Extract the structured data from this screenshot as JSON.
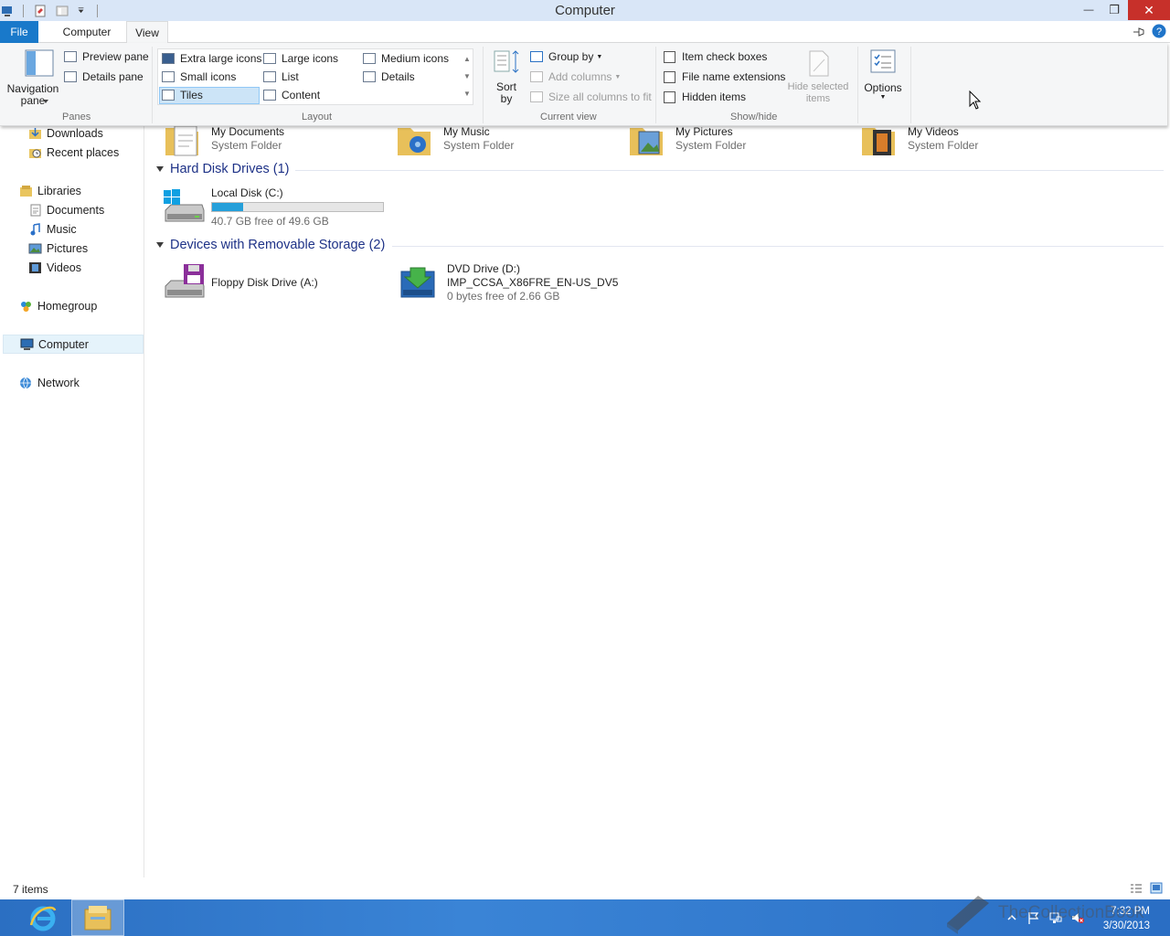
{
  "window": {
    "title": "Computer",
    "minimize": "—",
    "maximize": "❐",
    "close": "✕"
  },
  "tabs": {
    "file": "File",
    "computer": "Computer",
    "view": "View"
  },
  "ribbon": {
    "panes": {
      "label": "Panes",
      "navigation_pane": "Navigation pane",
      "preview_pane": "Preview pane",
      "details_pane": "Details pane"
    },
    "layout": {
      "label": "Layout",
      "items": [
        "Extra large icons",
        "Large icons",
        "Medium icons",
        "Small icons",
        "List",
        "Details",
        "Tiles",
        "Content"
      ],
      "selected": "Tiles"
    },
    "current_view": {
      "label": "Current view",
      "sort_by": "Sort by",
      "group_by": "Group by",
      "add_columns": "Add columns",
      "size_all_columns": "Size all columns to fit"
    },
    "show_hide": {
      "label": "Show/hide",
      "item_check_boxes": "Item check boxes",
      "file_name_extensions": "File name extensions",
      "hidden_items": "Hidden items",
      "hide_selected_items": "Hide selected items"
    },
    "options": "Options"
  },
  "nav": {
    "downloads": "Downloads",
    "recent_places": "Recent places",
    "libraries": "Libraries",
    "documents": "Documents",
    "music": "Music",
    "pictures": "Pictures",
    "videos": "Videos",
    "homegroup": "Homegroup",
    "computer": "Computer",
    "network": "Network"
  },
  "content": {
    "folders": [
      {
        "name": "My Documents",
        "type": "System Folder"
      },
      {
        "name": "My Music",
        "type": "System Folder"
      },
      {
        "name": "My Pictures",
        "type": "System Folder"
      },
      {
        "name": "My Videos",
        "type": "System Folder"
      }
    ],
    "hard_disk_header": "Hard Disk Drives (1)",
    "local_disk": {
      "name": "Local Disk (C:)",
      "free": "40.7 GB free of 49.6 GB",
      "used_fraction": 0.18
    },
    "removable_header": "Devices with Removable Storage (2)",
    "floppy": {
      "name": "Floppy Disk Drive (A:)"
    },
    "dvd": {
      "name": "DVD Drive (D:)",
      "label": "IMP_CCSA_X86FRE_EN-US_DV5",
      "free": "0 bytes free of 2.66 GB"
    }
  },
  "status": {
    "count": "7 items"
  },
  "taskbar": {
    "time": "7:32 PM",
    "date": "3/30/2013"
  },
  "watermark": "TheCollectionBook"
}
